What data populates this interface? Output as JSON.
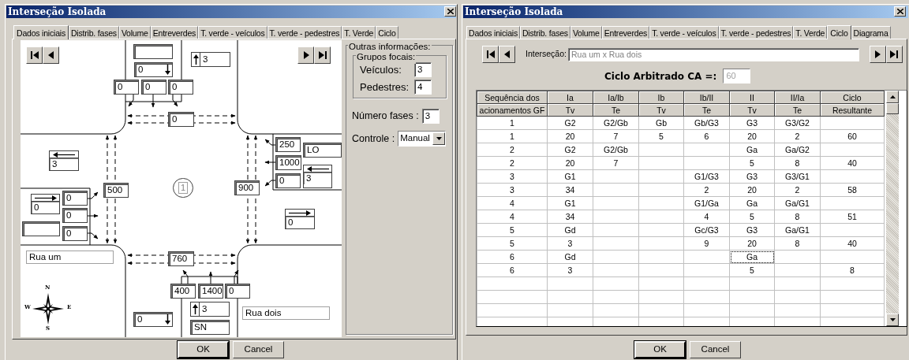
{
  "left_window": {
    "title": "Interseção Isolada",
    "tabs": [
      {
        "label": "Dados iniciais",
        "selected": true
      },
      {
        "label": "Distrib. fases",
        "selected": false
      },
      {
        "label": "Volume",
        "selected": false
      },
      {
        "label": "Entreverdes",
        "selected": false
      },
      {
        "label": "T. verde - veículos",
        "selected": false
      },
      {
        "label": "T. verde - pedestres",
        "selected": false
      },
      {
        "label": "T. Verde",
        "selected": false
      },
      {
        "label": "Ciclo",
        "selected": false
      }
    ],
    "diagram": {
      "fields": [
        {
          "kind": "up",
          "value": "3"
        },
        {
          "kind": "down",
          "value": "0"
        },
        {
          "kind": "box",
          "value": "0"
        },
        {
          "kind": "box",
          "value": "0"
        },
        {
          "kind": "box",
          "value": "0"
        },
        {
          "kind": "box",
          "value": "0"
        },
        {
          "kind": "box",
          "value": "250"
        },
        {
          "kind": "box",
          "value": "LO"
        },
        {
          "kind": "left",
          "value": "3"
        },
        {
          "kind": "box",
          "value": "1000"
        },
        {
          "kind": "left",
          "value": "3"
        },
        {
          "kind": "box",
          "value": "0"
        },
        {
          "kind": "box",
          "value": "900"
        },
        {
          "kind": "box",
          "value": "500"
        },
        {
          "kind": "right",
          "value": "0"
        },
        {
          "kind": "box",
          "value": "0"
        },
        {
          "kind": "box",
          "value": "0"
        },
        {
          "kind": "right",
          "value": "0"
        },
        {
          "kind": "box",
          "value": "0"
        },
        {
          "kind": "street",
          "value": "Rua um"
        },
        {
          "kind": "box",
          "value": "760"
        },
        {
          "kind": "box",
          "value": "400"
        },
        {
          "kind": "box",
          "value": "1400"
        },
        {
          "kind": "box",
          "value": "0"
        },
        {
          "kind": "up",
          "value": "3"
        },
        {
          "kind": "street",
          "value": "Rua dois"
        },
        {
          "kind": "down",
          "value": "0"
        },
        {
          "kind": "box",
          "value": "SN"
        }
      ],
      "phase": "1",
      "compass": [
        "N",
        "W",
        "E",
        "S"
      ]
    },
    "info": {
      "title": "Outras informações:",
      "group_title": "Grupos focais:",
      "group_fields": [
        {
          "label": "Veículos:",
          "value": "3"
        },
        {
          "label": "Pedestres:",
          "value": "4"
        }
      ],
      "phases": {
        "label": "Número fases :",
        "value": "3"
      },
      "control": {
        "label": "Controle :",
        "value": "Manual"
      }
    },
    "buttons": [
      {
        "label": "OK",
        "default": true
      },
      {
        "label": "Cancel",
        "default": false
      }
    ]
  },
  "right_window": {
    "title": "Interseção Isolada",
    "tabs": [
      {
        "label": "Dados iniciais",
        "selected": false
      },
      {
        "label": "Distrib. fases",
        "selected": false
      },
      {
        "label": "Volume",
        "selected": false
      },
      {
        "label": "Entreverdes",
        "selected": false
      },
      {
        "label": "T. verde - veículos",
        "selected": false
      },
      {
        "label": "T. verde - pedestres",
        "selected": false
      },
      {
        "label": "T. Verde",
        "selected": false
      },
      {
        "label": "Ciclo",
        "selected": true
      },
      {
        "label": "Diagrama",
        "selected": false
      }
    ],
    "intersection": {
      "label": "Interseção:",
      "value": "Rua um x Rua dois"
    },
    "cycle": {
      "label": "Ciclo Arbitrado CA =:",
      "value": "60"
    },
    "table": {
      "columns": [
        {
          "top": "Sequência dos",
          "bottom": "acionamentos GF"
        },
        {
          "top": "Ia",
          "bottom": "Tv"
        },
        {
          "top": "Ia/Ib",
          "bottom": "Te"
        },
        {
          "top": "Ib",
          "bottom": "Tv"
        },
        {
          "top": "Ib/II",
          "bottom": "Te"
        },
        {
          "top": "II",
          "bottom": "Tv"
        },
        {
          "top": "II/Ia",
          "bottom": "Te"
        },
        {
          "top": "Ciclo",
          "bottom": "Resultante"
        }
      ],
      "rows": [
        {
          "cells": [
            "1",
            "G2",
            "G2/Gb",
            "Gb",
            "Gb/G3",
            "G3",
            "G3/G2",
            null
          ]
        },
        {
          "cells": [
            "1",
            "20",
            "7",
            "5",
            "6",
            "20",
            "2",
            "60"
          ]
        },
        {
          "cells": [
            "2",
            "G2",
            "G2/Gb",
            null,
            null,
            "Ga",
            "Ga/G2",
            null
          ]
        },
        {
          "cells": [
            "2",
            "20",
            "7",
            null,
            null,
            "5",
            "8",
            "40"
          ]
        },
        {
          "cells": [
            "3",
            "G1",
            null,
            null,
            "G1/G3",
            "G3",
            "G3/G1",
            null
          ]
        },
        {
          "cells": [
            "3",
            "34",
            null,
            null,
            "2",
            "20",
            "2",
            "58"
          ]
        },
        {
          "cells": [
            "4",
            "G1",
            null,
            null,
            "G1/Ga",
            "Ga",
            "Ga/G1",
            null
          ]
        },
        {
          "cells": [
            "4",
            "34",
            null,
            null,
            "4",
            "5",
            "8",
            "51"
          ]
        },
        {
          "cells": [
            "5",
            "Gd",
            null,
            null,
            "Gc/G3",
            "G3",
            "Ga/G1",
            null
          ]
        },
        {
          "cells": [
            "5",
            "3",
            null,
            null,
            "9",
            "20",
            "8",
            "40"
          ]
        },
        {
          "cells": [
            "6",
            "Gd",
            null,
            null,
            null,
            {
              "text": "Ga",
              "focused": true
            },
            null,
            null
          ]
        },
        {
          "cells": [
            "6",
            "3",
            null,
            null,
            null,
            "5",
            null,
            "8"
          ]
        }
      ]
    },
    "buttons": [
      {
        "label": "OK",
        "default": true
      },
      {
        "label": "Cancel",
        "default": false
      }
    ]
  }
}
